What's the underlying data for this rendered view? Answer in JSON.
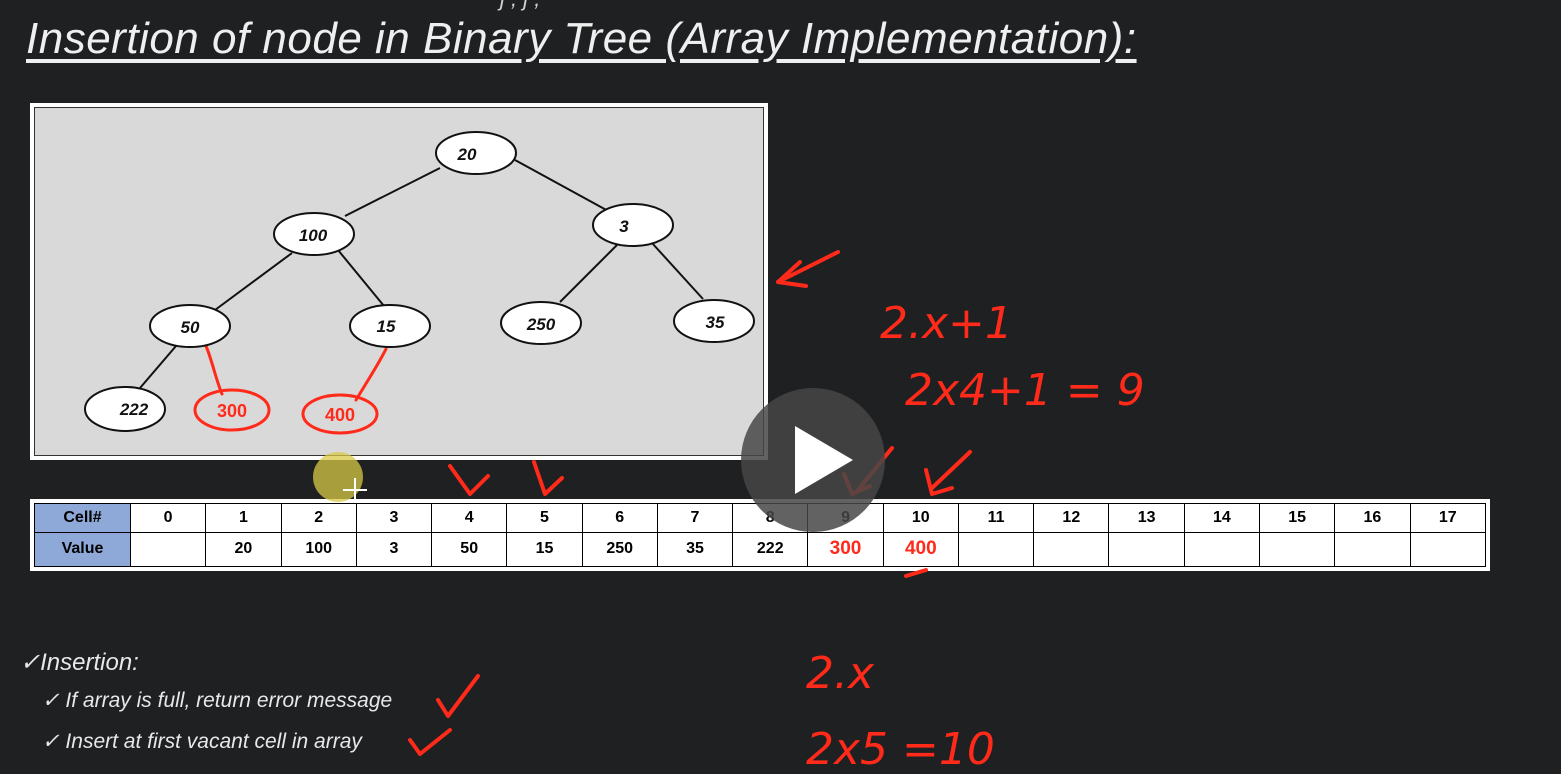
{
  "slide": {
    "title": "Insertion of node in Binary Tree (Array Implementation):",
    "top_clip": "j       ,  j ,"
  },
  "tree": {
    "nodes": [
      "20",
      "100",
      "3",
      "50",
      "15",
      "250",
      "35",
      "222"
    ],
    "handwritten_nodes": [
      "300",
      "400"
    ]
  },
  "array": {
    "cell_header": "Cell#",
    "value_header": "Value",
    "cells": [
      "0",
      "1",
      "2",
      "3",
      "4",
      "5",
      "6",
      "7",
      "8",
      "9",
      "10",
      "11",
      "12",
      "13",
      "14",
      "15",
      "16",
      "17"
    ],
    "values": [
      "",
      "20",
      "100",
      "3",
      "50",
      "15",
      "250",
      "35",
      "222",
      "300",
      "400",
      "",
      "",
      "",
      "",
      "",
      "",
      ""
    ]
  },
  "bullets": {
    "heading": "✓Insertion:",
    "items": [
      "✓ If array is full, return error message",
      "✓ Insert at first vacant cell in array"
    ]
  },
  "annotations": {
    "formula1": "2.x+1",
    "formula2": "2x4+1 = 9",
    "formula3": "2.x",
    "formula4": "2x5 =10"
  },
  "colors": {
    "background": "#1e2022",
    "annotation": "#ff2a1a",
    "header_cell": "#8ea9d8"
  },
  "player": {
    "play_icon": "play-icon"
  }
}
